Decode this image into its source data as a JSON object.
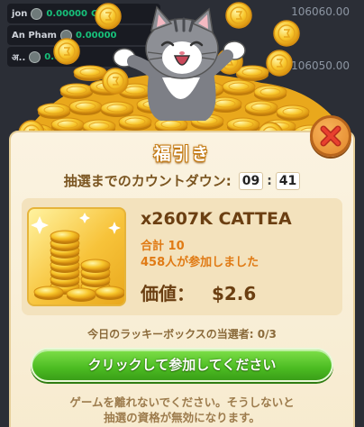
{
  "leaderboard": [
    {
      "name": "jon",
      "amount": "0.00000",
      "extra": "Cat",
      "score": "106060.00"
    },
    {
      "name": "An Pham",
      "amount": "0.00000",
      "extra": "",
      "score": ""
    },
    {
      "name": "अ..",
      "amount": "0.00",
      "extra": "",
      "score": "106050.00"
    }
  ],
  "modal": {
    "title": "福引き",
    "countdown_label": "抽選までのカウントダウン:",
    "countdown_minutes": "09",
    "countdown_seconds": "41",
    "prize": {
      "title": "x2607K CATTEA",
      "total": "合計 10",
      "joined": "458人が参加しました",
      "value_label": "価値：",
      "value": "$2.6"
    },
    "lucky_label": "今日のラッキーボックスの当選者: 0/3",
    "join_button": "クリックして参加してください",
    "notice_line1": "ゲームを離れないでください。そうしないと",
    "notice_line2": "抽選の資格が無効になります。"
  },
  "icons": {
    "close": "close-x-icon",
    "coin": "coin-icon",
    "cat": "cat-mascot"
  },
  "colors": {
    "accent_orange": "#e07a14",
    "button_green": "#4cbc22",
    "text_brown": "#6b3f12"
  }
}
